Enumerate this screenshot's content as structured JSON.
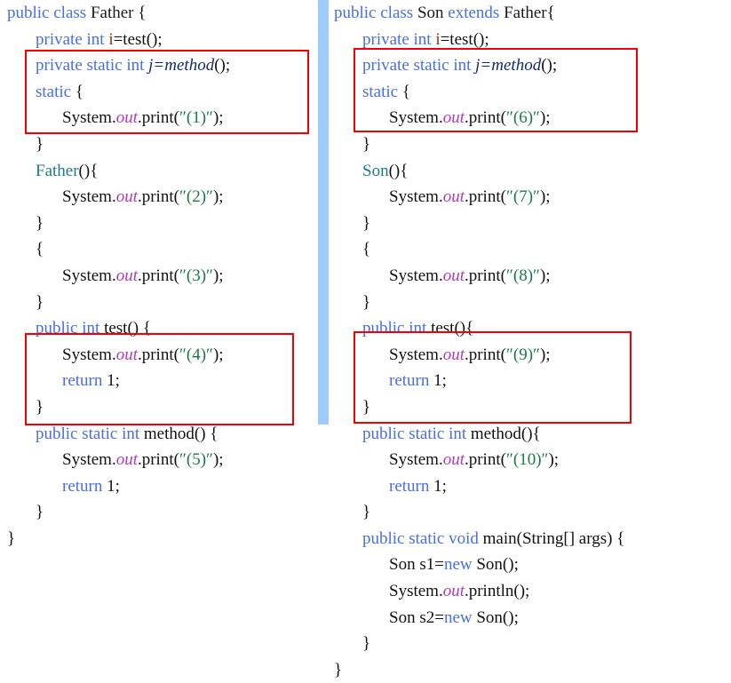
{
  "document": {
    "title": "Java static initialization order example",
    "type": "code-comparison-slide"
  },
  "colors": {
    "keyword": "#4a6fe0",
    "string": "#1c7a4a",
    "constructor": "#1f7a8c",
    "field": "#8b2f2f",
    "out_reference": "#b03bb5",
    "highlight_box": "#f50000",
    "divider": "#9ecbfb",
    "background": "#ffffff",
    "plain_text": "#111111"
  },
  "divider": {
    "name": "vertical-divider",
    "orientation": "vertical"
  },
  "left_panel": {
    "class_name": "Father",
    "lines": [
      {
        "id": "l0",
        "indent": 0,
        "tokens": [
          {
            "t": "public class ",
            "c": "kw"
          },
          {
            "t": "Father",
            "c": "type"
          },
          {
            "t": " {",
            "c": "plain"
          }
        ]
      },
      {
        "id": "l1",
        "indent": 1,
        "tokens": [
          {
            "t": "private int ",
            "c": "kw"
          },
          {
            "t": "i",
            "c": "field"
          },
          {
            "t": "=test();",
            "c": "plain"
          }
        ]
      },
      {
        "id": "l2",
        "indent": 1,
        "tokens": [
          {
            "t": "private static int ",
            "c": "kw"
          },
          {
            "t": "j=method",
            "c": "fieldj"
          },
          {
            "t": "();",
            "c": "plain"
          }
        ]
      },
      {
        "id": "l3",
        "indent": 1,
        "tokens": [
          {
            "t": "static",
            "c": "kw"
          },
          {
            "t": " {",
            "c": "plain"
          }
        ]
      },
      {
        "id": "l4",
        "indent": 2,
        "tokens": [
          {
            "t": "System.",
            "c": "plain"
          },
          {
            "t": "out",
            "c": "outref"
          },
          {
            "t": ".print(",
            "c": "plain"
          },
          {
            "t": "″(1)″",
            "c": "str"
          },
          {
            "t": ");",
            "c": "plain"
          }
        ]
      },
      {
        "id": "l5",
        "indent": 1,
        "tokens": [
          {
            "t": "}",
            "c": "plain"
          }
        ]
      },
      {
        "id": "l6",
        "indent": 1,
        "tokens": [
          {
            "t": "Father",
            "c": "ctor"
          },
          {
            "t": "(){",
            "c": "plain"
          }
        ]
      },
      {
        "id": "l7",
        "indent": 2,
        "tokens": [
          {
            "t": "System.",
            "c": "plain"
          },
          {
            "t": "out",
            "c": "outref"
          },
          {
            "t": ".print(",
            "c": "plain"
          },
          {
            "t": "″(2)″",
            "c": "str"
          },
          {
            "t": ");",
            "c": "plain"
          }
        ]
      },
      {
        "id": "l8",
        "indent": 1,
        "tokens": [
          {
            "t": "}",
            "c": "plain"
          }
        ]
      },
      {
        "id": "l9",
        "indent": 1,
        "tokens": [
          {
            "t": "{",
            "c": "plain"
          }
        ]
      },
      {
        "id": "l10",
        "indent": 2,
        "tokens": [
          {
            "t": "System.",
            "c": "plain"
          },
          {
            "t": "out",
            "c": "outref"
          },
          {
            "t": ".print(",
            "c": "plain"
          },
          {
            "t": "″(3)″",
            "c": "str"
          },
          {
            "t": ");",
            "c": "plain"
          }
        ]
      },
      {
        "id": "l11",
        "indent": 1,
        "tokens": [
          {
            "t": "}",
            "c": "plain"
          }
        ]
      },
      {
        "id": "l12",
        "indent": 1,
        "tokens": [
          {
            "t": "public int ",
            "c": "kw"
          },
          {
            "t": "test() {",
            "c": "plain"
          }
        ]
      },
      {
        "id": "l13",
        "indent": 2,
        "tokens": [
          {
            "t": "System.",
            "c": "plain"
          },
          {
            "t": "out",
            "c": "outref"
          },
          {
            "t": ".print(",
            "c": "plain"
          },
          {
            "t": "″(4)″",
            "c": "str"
          },
          {
            "t": ");",
            "c": "plain"
          }
        ]
      },
      {
        "id": "l14",
        "indent": 2,
        "tokens": [
          {
            "t": "return",
            "c": "kw"
          },
          {
            "t": " 1;",
            "c": "num"
          }
        ]
      },
      {
        "id": "l15",
        "indent": 1,
        "tokens": [
          {
            "t": "}",
            "c": "plain"
          }
        ]
      },
      {
        "id": "l16",
        "indent": 1,
        "tokens": [
          {
            "t": "public static int ",
            "c": "kw"
          },
          {
            "t": "method() {",
            "c": "plain"
          }
        ]
      },
      {
        "id": "l17",
        "indent": 2,
        "tokens": [
          {
            "t": "System.",
            "c": "plain"
          },
          {
            "t": "out",
            "c": "outref"
          },
          {
            "t": ".print(",
            "c": "plain"
          },
          {
            "t": "″(5)″",
            "c": "str"
          },
          {
            "t": ");",
            "c": "plain"
          }
        ]
      },
      {
        "id": "l18",
        "indent": 2,
        "tokens": [
          {
            "t": "return",
            "c": "kw"
          },
          {
            "t": " 1;",
            "c": "num"
          }
        ]
      },
      {
        "id": "l19",
        "indent": 1,
        "tokens": [
          {
            "t": "}",
            "c": "plain"
          }
        ]
      },
      {
        "id": "l20",
        "indent": 0,
        "tokens": [
          {
            "t": "}",
            "c": "plain"
          }
        ]
      }
    ],
    "plain_text": [
      "public class Father {",
      "   private int i=test();",
      "   private static int j=method();",
      "   static {",
      "      System.out.print(\"(1)\");",
      "   }",
      "   Father(){",
      "      System.out.print(\"(2)\");",
      "   }",
      "   {",
      "      System.out.print(\"(3)\");",
      "   }",
      "   public int test() {",
      "      System.out.print(\"(4)\");",
      "      return 1;",
      "   }",
      "   public static int method() {",
      "      System.out.print(\"(5)\");",
      "      return 1;",
      "   }",
      "}"
    ],
    "highlight_boxes": [
      {
        "name": "static-init-block-father",
        "lines": "2-5"
      },
      {
        "name": "static-method-father",
        "lines": "16-19"
      }
    ]
  },
  "right_panel": {
    "class_name": "Son",
    "extends": "Father",
    "lines": [
      {
        "id": "r0",
        "indent": 0,
        "tokens": [
          {
            "t": "public class ",
            "c": "kw"
          },
          {
            "t": "Son",
            "c": "type"
          },
          {
            "t": " ",
            "c": "plain"
          },
          {
            "t": "extends",
            "c": "kw"
          },
          {
            "t": " ",
            "c": "plain"
          },
          {
            "t": "Father",
            "c": "type"
          },
          {
            "t": "{",
            "c": "plain"
          }
        ]
      },
      {
        "id": "r1",
        "indent": 1,
        "tokens": [
          {
            "t": "private int ",
            "c": "kw"
          },
          {
            "t": "i",
            "c": "field"
          },
          {
            "t": "=test();",
            "c": "plain"
          }
        ]
      },
      {
        "id": "r2",
        "indent": 1,
        "tokens": [
          {
            "t": "private static int ",
            "c": "kw"
          },
          {
            "t": "j=method",
            "c": "fieldj"
          },
          {
            "t": "();",
            "c": "plain"
          }
        ]
      },
      {
        "id": "r3",
        "indent": 1,
        "tokens": [
          {
            "t": "static",
            "c": "kw"
          },
          {
            "t": " {",
            "c": "plain"
          }
        ]
      },
      {
        "id": "r4",
        "indent": 2,
        "tokens": [
          {
            "t": "System.",
            "c": "plain"
          },
          {
            "t": "out",
            "c": "outref"
          },
          {
            "t": ".print(",
            "c": "plain"
          },
          {
            "t": "″(6)″",
            "c": "str"
          },
          {
            "t": ");",
            "c": "plain"
          }
        ]
      },
      {
        "id": "r5",
        "indent": 1,
        "tokens": [
          {
            "t": "}",
            "c": "plain"
          }
        ]
      },
      {
        "id": "r6",
        "indent": 1,
        "tokens": [
          {
            "t": "Son",
            "c": "ctor"
          },
          {
            "t": "(){",
            "c": "plain"
          }
        ]
      },
      {
        "id": "r7",
        "indent": 2,
        "tokens": [
          {
            "t": "System.",
            "c": "plain"
          },
          {
            "t": "out",
            "c": "outref"
          },
          {
            "t": ".print(",
            "c": "plain"
          },
          {
            "t": "″(7)″",
            "c": "str"
          },
          {
            "t": ");",
            "c": "plain"
          }
        ]
      },
      {
        "id": "r8",
        "indent": 1,
        "tokens": [
          {
            "t": "}",
            "c": "plain"
          }
        ]
      },
      {
        "id": "r9",
        "indent": 1,
        "tokens": [
          {
            "t": "{",
            "c": "plain"
          }
        ]
      },
      {
        "id": "r10",
        "indent": 2,
        "tokens": [
          {
            "t": "System.",
            "c": "plain"
          },
          {
            "t": "out",
            "c": "outref"
          },
          {
            "t": ".print(",
            "c": "plain"
          },
          {
            "t": "″(8)″",
            "c": "str"
          },
          {
            "t": ");",
            "c": "plain"
          }
        ]
      },
      {
        "id": "r11",
        "indent": 1,
        "tokens": [
          {
            "t": "}",
            "c": "plain"
          }
        ]
      },
      {
        "id": "r12",
        "indent": 1,
        "tokens": [
          {
            "t": "public int ",
            "c": "kw"
          },
          {
            "t": "test(){",
            "c": "plain"
          }
        ]
      },
      {
        "id": "r13",
        "indent": 2,
        "tokens": [
          {
            "t": "System.",
            "c": "plain"
          },
          {
            "t": "out",
            "c": "outref"
          },
          {
            "t": ".print(",
            "c": "plain"
          },
          {
            "t": "″(9)″",
            "c": "str"
          },
          {
            "t": ");",
            "c": "plain"
          }
        ]
      },
      {
        "id": "r14",
        "indent": 2,
        "tokens": [
          {
            "t": "return",
            "c": "kw"
          },
          {
            "t": " 1;",
            "c": "num"
          }
        ]
      },
      {
        "id": "r15",
        "indent": 1,
        "tokens": [
          {
            "t": "}",
            "c": "plain"
          }
        ]
      },
      {
        "id": "r16",
        "indent": 1,
        "tokens": [
          {
            "t": "public static int ",
            "c": "kw"
          },
          {
            "t": "method(){",
            "c": "plain"
          }
        ]
      },
      {
        "id": "r17",
        "indent": 2,
        "tokens": [
          {
            "t": "System.",
            "c": "plain"
          },
          {
            "t": "out",
            "c": "outref"
          },
          {
            "t": ".print(",
            "c": "plain"
          },
          {
            "t": "″(10)″",
            "c": "str"
          },
          {
            "t": ");",
            "c": "plain"
          }
        ]
      },
      {
        "id": "r18",
        "indent": 2,
        "tokens": [
          {
            "t": "return",
            "c": "kw"
          },
          {
            "t": " 1;",
            "c": "num"
          }
        ]
      },
      {
        "id": "r19",
        "indent": 1,
        "tokens": [
          {
            "t": "}",
            "c": "plain"
          }
        ]
      },
      {
        "id": "r20",
        "indent": 1,
        "tokens": [
          {
            "t": "public static void ",
            "c": "kw"
          },
          {
            "t": "main(String[] args) {",
            "c": "plain"
          }
        ]
      },
      {
        "id": "r21",
        "indent": 2,
        "tokens": [
          {
            "t": "Son",
            "c": "plain"
          },
          {
            "t": " s1=",
            "c": "plain"
          },
          {
            "t": "new",
            "c": "kw"
          },
          {
            "t": " Son();",
            "c": "plain"
          }
        ]
      },
      {
        "id": "r22",
        "indent": 2,
        "tokens": [
          {
            "t": "System.",
            "c": "plain"
          },
          {
            "t": "out",
            "c": "outref"
          },
          {
            "t": ".println();",
            "c": "plain"
          }
        ]
      },
      {
        "id": "r23",
        "indent": 2,
        "tokens": [
          {
            "t": "Son",
            "c": "plain"
          },
          {
            "t": " s2=",
            "c": "plain"
          },
          {
            "t": "new",
            "c": "kw"
          },
          {
            "t": " Son();",
            "c": "plain"
          }
        ]
      },
      {
        "id": "r24",
        "indent": 1,
        "tokens": [
          {
            "t": "}",
            "c": "plain"
          }
        ]
      },
      {
        "id": "r25",
        "indent": 0,
        "tokens": [
          {
            "t": "}",
            "c": "plain"
          }
        ]
      }
    ],
    "plain_text": [
      "public class Son extends Father{",
      "   private int i=test();",
      "   private static int j=method();",
      "   static {",
      "      System.out.print(\"(6)\");",
      "   }",
      "   Son(){",
      "      System.out.print(\"(7)\");",
      "   }",
      "   {",
      "      System.out.print(\"(8)\");",
      "   }",
      "   public int test(){",
      "      System.out.print(\"(9)\");",
      "      return 1;",
      "   }",
      "   public static int method(){",
      "      System.out.print(\"(10)\");",
      "      return 1;",
      "   }",
      "   public static void main(String[] args) {",
      "      Son s1=new Son();",
      "      System.out.println();",
      "      Son s2=new Son();",
      "   }",
      "}"
    ],
    "highlight_boxes": [
      {
        "name": "static-init-block-son",
        "lines": "2-5"
      },
      {
        "name": "static-method-son",
        "lines": "16-19"
      }
    ]
  }
}
